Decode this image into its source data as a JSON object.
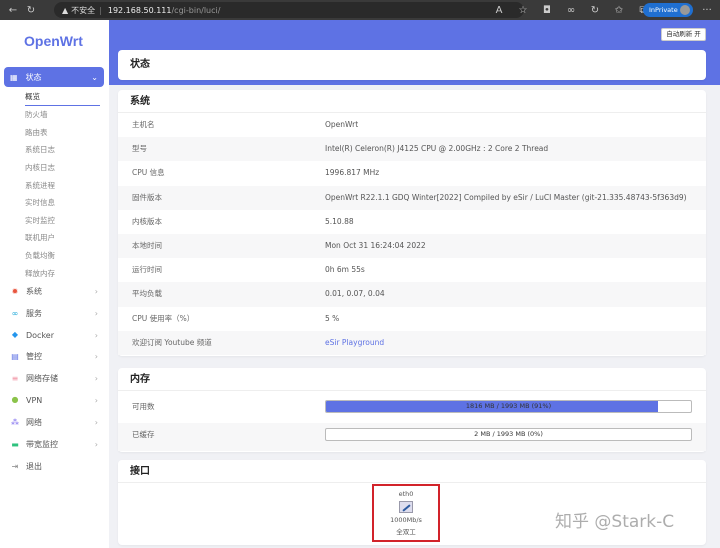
{
  "browser": {
    "warning": "不安全",
    "url_host": "192.168.50.111",
    "url_path": "/cgi-bin/luci/",
    "inprivate": "InPrivate"
  },
  "logo": "OpenWrt",
  "auto_refresh": "自动刷新 开",
  "sidebar": {
    "active": {
      "label": "状态"
    },
    "sub_items": [
      "概览",
      "防火墙",
      "路由表",
      "系统日志",
      "内核日志",
      "系统进程",
      "实时信息",
      "实时监控",
      "联机用户",
      "负载均衡",
      "释放内存"
    ],
    "items": [
      {
        "label": "系统",
        "icon": "gear-icon",
        "color": "#e8553e"
      },
      {
        "label": "服务",
        "icon": "link-icon",
        "color": "#1aa7d8"
      },
      {
        "label": "Docker",
        "icon": "docker-icon",
        "color": "#2496ed"
      },
      {
        "label": "管控",
        "icon": "control-icon",
        "color": "#5e72e4"
      },
      {
        "label": "网络存储",
        "icon": "storage-icon",
        "color": "#f08fa0"
      },
      {
        "label": "VPN",
        "icon": "globe-icon",
        "color": "#8bc34a"
      },
      {
        "label": "网络",
        "icon": "network-icon",
        "color": "#7b68ee"
      },
      {
        "label": "带宽监控",
        "icon": "monitor-icon",
        "color": "#2ec27e"
      },
      {
        "label": "退出",
        "icon": "logout-icon",
        "color": "#888"
      }
    ]
  },
  "page_title": "状态",
  "system": {
    "title": "系统",
    "rows": [
      {
        "k": "主机名",
        "v": "OpenWrt"
      },
      {
        "k": "型号",
        "v": "Intel(R) Celeron(R) J4125 CPU @ 2.00GHz : 2 Core 2 Thread"
      },
      {
        "k": "CPU 信息",
        "v": "1996.817 MHz"
      },
      {
        "k": "固件版本",
        "v": "OpenWrt R22.1.1 GDQ Winter[2022] Compiled by eSir / LuCI Master (git-21.335.48743-5f363d9)"
      },
      {
        "k": "内核版本",
        "v": "5.10.88"
      },
      {
        "k": "本地时间",
        "v": "Mon Oct 31 16:24:04 2022"
      },
      {
        "k": "运行时间",
        "v": "0h 6m 55s"
      },
      {
        "k": "平均负载",
        "v": "0.01, 0.07, 0.04"
      },
      {
        "k": "CPU 使用率（%）",
        "v": "5 %"
      },
      {
        "k": "欢迎订阅 Youtube 频道",
        "v": "eSir Playground"
      }
    ]
  },
  "memory": {
    "title": "内存",
    "rows": [
      {
        "k": "可用数",
        "v": "1816 MB / 1993 MB (91%)",
        "percent": 91
      },
      {
        "k": "已缓存",
        "v": "2 MB / 1993 MB (0%)",
        "percent": 0
      }
    ]
  },
  "interfaces": {
    "title": "接口",
    "items": [
      {
        "name": "eth0",
        "speed": "1000Mb/s",
        "duplex": "全双工"
      }
    ]
  },
  "watermark": "知乎 @Stark-C"
}
